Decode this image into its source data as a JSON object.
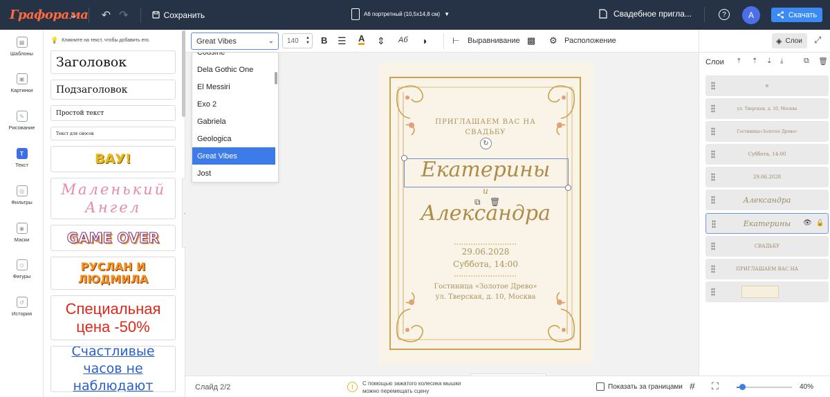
{
  "app": {
    "logo": "Графорама",
    "save_label": "Сохранить",
    "format_label": "А6 портретный (10,5x14,8 см)",
    "doc_title": "Свадебное пригла...",
    "avatar_letter": "A",
    "download_label": "Скачать"
  },
  "rail": {
    "items": [
      {
        "label": "Шаблоны",
        "icon": "templates-icon"
      },
      {
        "label": "Картинки",
        "icon": "images-icon"
      },
      {
        "label": "Рисование",
        "icon": "draw-icon"
      },
      {
        "label": "Текст",
        "icon": "text-icon"
      },
      {
        "label": "Фильтры",
        "icon": "filters-icon"
      },
      {
        "label": "Маски",
        "icon": "masks-icon"
      },
      {
        "label": "Фигуры",
        "icon": "shapes-icon"
      },
      {
        "label": "История",
        "icon": "history-icon"
      }
    ]
  },
  "presets": {
    "hint": "Кликните на текст, чтобы добавить его.",
    "items": [
      "Заголовок",
      "Подзаголовок",
      "Простой текст",
      "Текст для сносок",
      "ВАУ!",
      "Маленький Ангел",
      "GAME OVER",
      "РУСЛАН И ЛЮДМИЛА",
      "Специальная цена -50%",
      "Счастливые часов не наблюдают"
    ]
  },
  "toolbar": {
    "font": "Great Vibes",
    "size": "140",
    "align_label": "Выравнивание",
    "arrange_label": "Расположение",
    "layers_label": "Слои"
  },
  "dropdown": {
    "items": [
      "Cousine",
      "Dela Gothic One",
      "El Messiri",
      "Exo 2",
      "Gabriela",
      "Geologica",
      "Great Vibes",
      "Jost"
    ],
    "selected": "Great Vibes"
  },
  "card": {
    "invite_line1": "ПРИГЛАШАЕМ ВАС НА",
    "invite_line2": "СВАДЬБУ",
    "name1": "Екатерины",
    "conj": "и",
    "name2": "Александра",
    "date": "29.06.2028",
    "time": "Суббота, 14:00",
    "venue": "Гостиница «Золотое Древо»",
    "address": "ул. Тверская, д. 10, Москва"
  },
  "layers": {
    "title": "Слои",
    "items": [
      "и",
      "ул. Тверская, д. 10, Москва",
      "Гостиница«Золотое Древо»",
      "Суббота, 14:00",
      "29.06.2028",
      "Александра",
      "Екатерины",
      "СВАДЬБУ",
      "ПРИГЛАШАЕМ ВАС НА",
      ""
    ]
  },
  "bottom": {
    "slide_label": "Слайд 2/2",
    "scroll_hint": "С помощью зажатого колесика мышки можно перемещать сцену",
    "bounds_label": "Показать за границами",
    "zoom": "40%"
  },
  "colors": {
    "topbar": "#263346",
    "accent": "#3c8bf5",
    "gold": "#c8a24c",
    "card_bg": "#faf4e8"
  }
}
